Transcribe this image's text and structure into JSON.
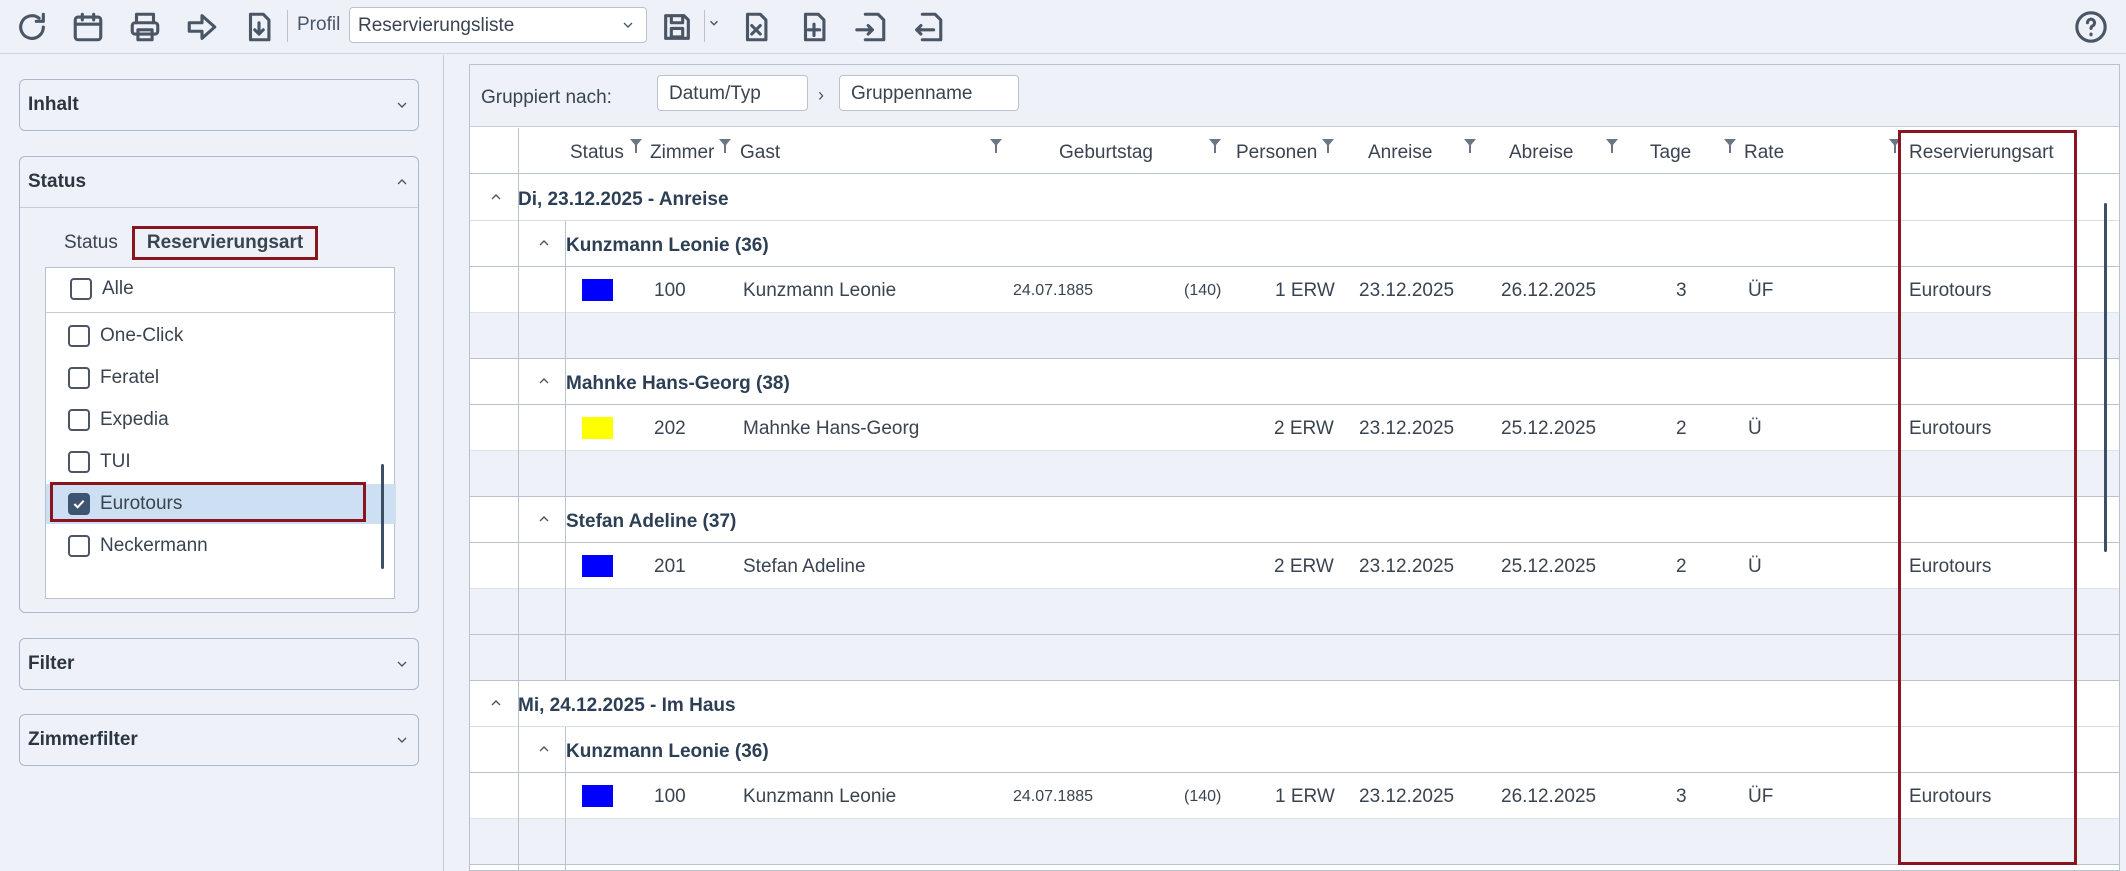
{
  "toolbar": {
    "icons": [
      "refresh-icon",
      "calendar-icon",
      "print-icon",
      "forward-icon",
      "download-icon",
      "save-icon",
      "excel-export-icon",
      "add-document-icon",
      "import-icon",
      "export-icon",
      "help-icon"
    ],
    "profil_label": "Profil",
    "profil_value": "Reservierungsliste"
  },
  "left_panel": {
    "sections": {
      "inhalt": "Inhalt",
      "status": "Status",
      "filter": "Filter",
      "zimmerfilter": "Zimmerfilter"
    },
    "subtabs": [
      "Status",
      "Reservierungsart"
    ],
    "list": {
      "all_label": "Alle",
      "items": [
        {
          "label": "One-Click",
          "checked": false
        },
        {
          "label": "Feratel",
          "checked": false
        },
        {
          "label": "Expedia",
          "checked": false
        },
        {
          "label": "TUI",
          "checked": false
        },
        {
          "label": "Eurotours",
          "checked": true
        },
        {
          "label": "Neckermann",
          "checked": false
        }
      ]
    }
  },
  "grid": {
    "grouped_by_label": "Gruppiert nach:",
    "group_chips": [
      "Datum/Typ",
      "Gruppenname"
    ],
    "columns": [
      "Status",
      "Zimmer",
      "Gast",
      "Geburtstag",
      "Personen",
      "Anreise",
      "Abreise",
      "Tage",
      "Rate",
      "Reservierungsart"
    ],
    "groups": [
      {
        "label": "Di, 23.12.2025 - Anreise",
        "subgroups": [
          {
            "label": "Kunzmann Leonie (36)",
            "row": {
              "color": "#0000ff",
              "zimmer": "100",
              "gast": "Kunzmann Leonie",
              "geburtstag": "24.07.1885",
              "age": "(140)",
              "personen": "1 ERW",
              "anreise": "23.12.2025",
              "abreise": "26.12.2025",
              "tage": "3",
              "rate": "ÜF",
              "art": "Eurotours"
            }
          },
          {
            "label": "Mahnke Hans-Georg (38)",
            "row": {
              "color": "#ffff00",
              "zimmer": "202",
              "gast": "Mahnke Hans-Georg",
              "geburtstag": "",
              "age": "",
              "personen": "2 ERW",
              "anreise": "23.12.2025",
              "abreise": "25.12.2025",
              "tage": "2",
              "rate": "Ü",
              "art": "Eurotours"
            }
          },
          {
            "label": "Stefan Adeline (37)",
            "row": {
              "color": "#0000ff",
              "zimmer": "201",
              "gast": "Stefan Adeline",
              "geburtstag": "",
              "age": "",
              "personen": "2 ERW",
              "anreise": "23.12.2025",
              "abreise": "25.12.2025",
              "tage": "2",
              "rate": "Ü",
              "art": "Eurotours"
            }
          }
        ]
      },
      {
        "label": "Mi, 24.12.2025 - Im Haus",
        "subgroups": [
          {
            "label": "Kunzmann Leonie (36)",
            "row": {
              "color": "#0000ff",
              "zimmer": "100",
              "gast": "Kunzmann Leonie",
              "geburtstag": "24.07.1885",
              "age": "(140)",
              "personen": "1 ERW",
              "anreise": "23.12.2025",
              "abreise": "26.12.2025",
              "tage": "3",
              "rate": "ÜF",
              "art": "Eurotours"
            }
          }
        ]
      }
    ]
  }
}
